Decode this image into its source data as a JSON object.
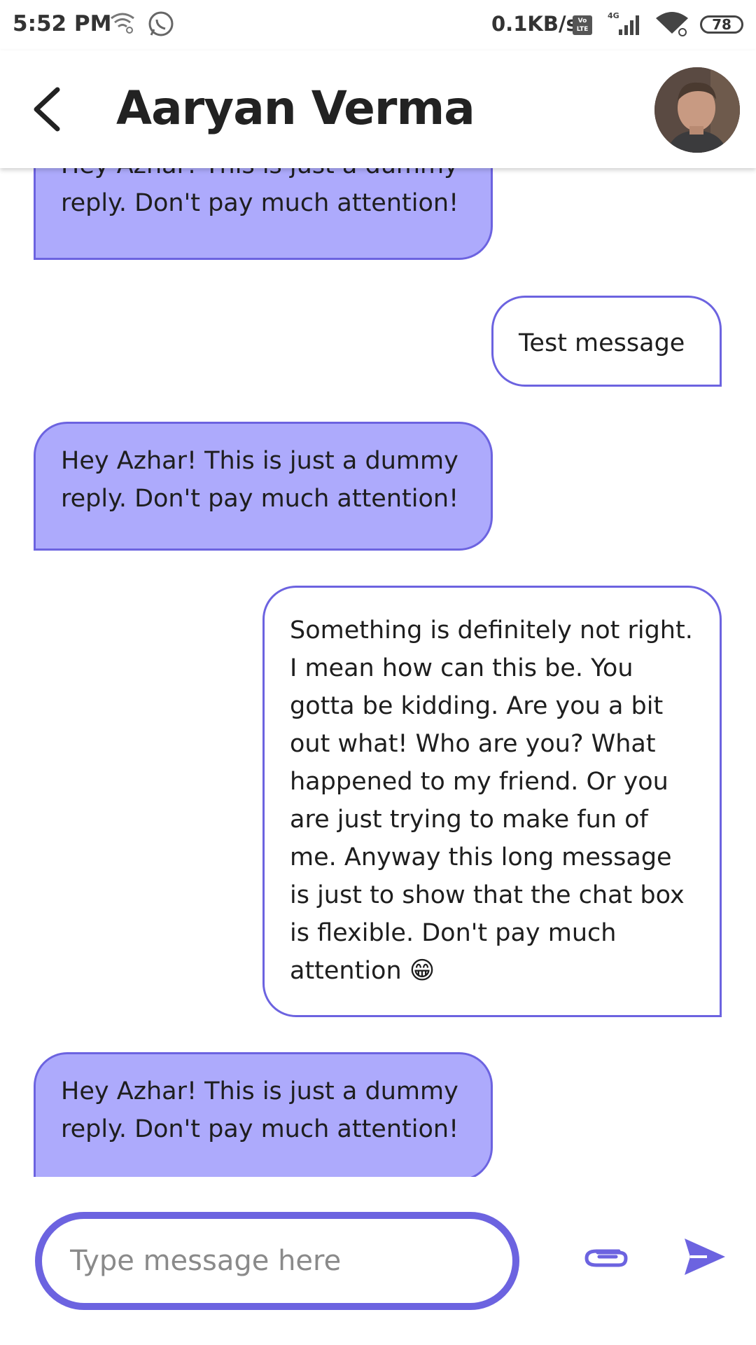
{
  "status_bar": {
    "time": "5:52 PM",
    "network_speed": "0.1KB/s",
    "volte": "Vo LTE",
    "network_type": "4G",
    "battery": "78",
    "icons": [
      "wifi-link-icon",
      "whatsapp-icon",
      "volte-icon",
      "cell-signal-icon",
      "wifi-icon",
      "battery-icon"
    ]
  },
  "header": {
    "title": "Aaryan Verma",
    "back_icon": "chevron-left-icon",
    "avatar_icon": "user-avatar"
  },
  "messages": [
    {
      "type": "received",
      "text": "Hey Azhar! This is just a dummy reply. Don't pay much attention!"
    },
    {
      "type": "sent",
      "text": "Test message"
    },
    {
      "type": "received",
      "text": "Hey Azhar! This is just a dummy reply. Don't pay much attention!"
    },
    {
      "type": "sent",
      "text": "Something is definitely not right. I mean how can this be. You gotta be kidding. Are you a bit out what! Who are you? What happened to my friend. Or you are just trying to make fun of me. Anyway this long message is just to show that the chat box is flexible. Don't pay much attention 😁"
    },
    {
      "type": "received",
      "text": "Hey Azhar! This is just a dummy reply. Don't pay much attention!"
    }
  ],
  "composer": {
    "placeholder": "Type message here",
    "value": "",
    "attach_icon": "paperclip-icon",
    "send_icon": "send-icon"
  },
  "colors": {
    "accent": "#6c63e0",
    "received_bubble": "#adaafc",
    "sent_bubble": "#ffffff"
  }
}
